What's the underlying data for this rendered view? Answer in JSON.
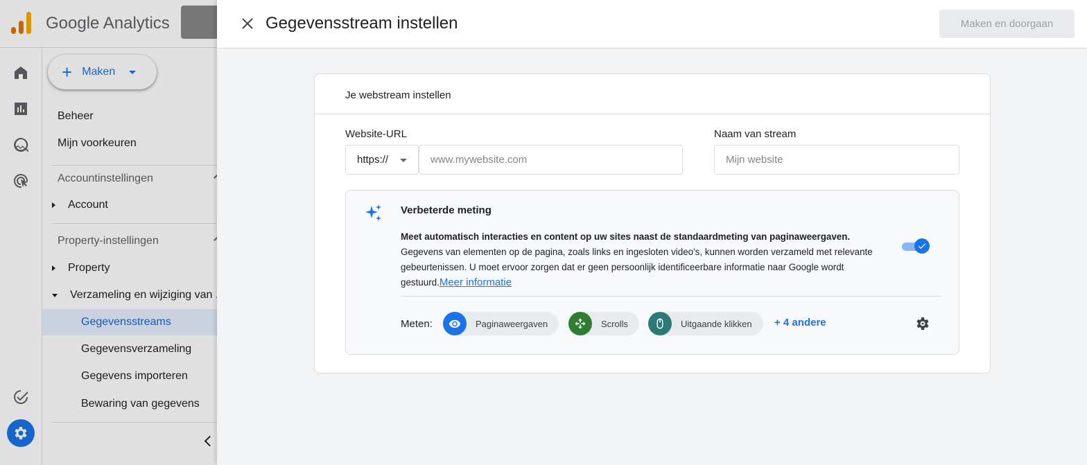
{
  "app": {
    "brand": "Google Analytics"
  },
  "sidenav": {
    "create_label": "Maken",
    "admin": "Beheer",
    "preferences": "Mijn voorkeuren",
    "account_section": "Accountinstellingen",
    "account_item": "Account",
    "property_section": "Property-instellingen",
    "property_item": "Property",
    "collection_item": "Verzameling en wijziging van ...",
    "sub_items": [
      "Gegevensstreams",
      "Gegevensverzameling",
      "Gegevens importeren",
      "Bewaring van gegevens"
    ],
    "active_sub_item": "Gegevensstreams"
  },
  "dialog": {
    "title": "Gegevensstream instellen",
    "continue_button": "Maken en doorgaan",
    "card_title": "Je webstream instellen",
    "website_url_label": "Website-URL",
    "protocol_value": "https://",
    "url_placeholder": "www.mywebsite.com",
    "stream_name_label": "Naam van stream",
    "stream_name_placeholder": "Mijn website",
    "enhanced": {
      "title": "Verbeterde meting",
      "desc_bold": "Meet automatisch interacties en content op uw sites naast de standaardmeting van paginaweergaven.",
      "desc": "Gegevens van elementen op de pagina, zoals links en ingesloten video's, kunnen worden verzameld met relevante gebeurtenissen. U moet ervoor zorgen dat er geen persoonlijk identificeerbare informatie naar Google wordt gestuurd.",
      "link": "Meer informatie",
      "toggle_on": true,
      "measure_label": "Meten:",
      "chips": [
        {
          "label": "Paginaweergaven",
          "icon": "eye-icon",
          "color": "#1a73e8"
        },
        {
          "label": "Scrolls",
          "icon": "scroll-move-icon",
          "color": "#2e7d32"
        },
        {
          "label": "Uitgaande klikken",
          "icon": "mouse-icon",
          "color": "#2b7a78"
        }
      ],
      "more": "+ 4 andere"
    }
  },
  "colors": {
    "accent": "#1a73e8",
    "active_nav_bg": "#e8f0fe"
  }
}
